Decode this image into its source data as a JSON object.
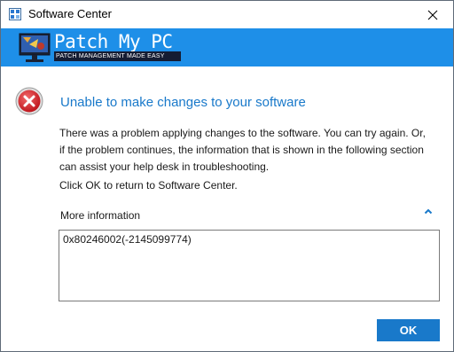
{
  "window": {
    "title": "Software Center"
  },
  "banner": {
    "logo_title": "Patch My PC",
    "logo_tagline": "PATCH MANAGEMENT MADE EASY",
    "background_color": "#1e8fe8"
  },
  "dialog": {
    "icon": "error-icon",
    "heading": "Unable to make changes to your software",
    "body": "There was a problem applying changes to the software.  You can try again. Or, if the problem continues, the information that is shown in the following section can assist your help desk in troubleshooting.",
    "instruction": "Click OK to return to Software Center.",
    "more_info_label": "More information",
    "error_code": "0x80246002(-2145099774)",
    "ok_label": "OK",
    "accent_color": "#1979ca"
  }
}
